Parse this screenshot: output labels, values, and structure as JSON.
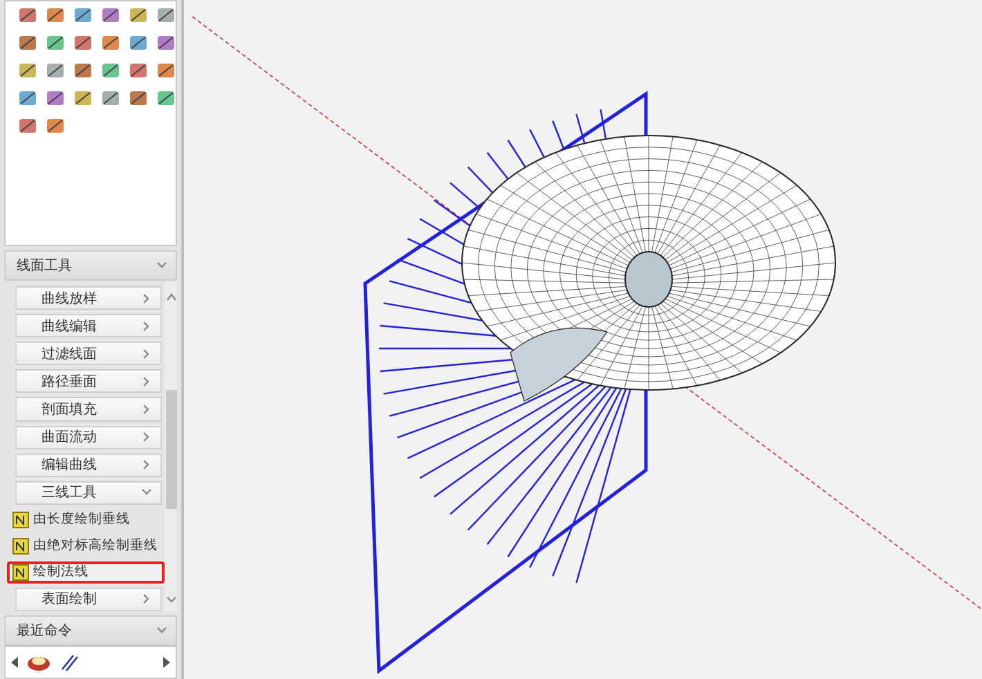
{
  "panel": {
    "tools_section": {
      "title": "线面工具",
      "items": [
        {
          "kind": "category",
          "label": "曲线放样",
          "expanded": false
        },
        {
          "kind": "category",
          "label": "曲线编辑",
          "expanded": false
        },
        {
          "kind": "category",
          "label": "过滤线面",
          "expanded": false
        },
        {
          "kind": "category",
          "label": "路径垂面",
          "expanded": false
        },
        {
          "kind": "category",
          "label": "剖面填充",
          "expanded": false
        },
        {
          "kind": "category",
          "label": "曲面流动",
          "expanded": false
        },
        {
          "kind": "category",
          "label": "编辑曲线",
          "expanded": false
        },
        {
          "kind": "category",
          "label": "三线工具",
          "expanded": true
        },
        {
          "kind": "command",
          "label": "由长度绘制垂线",
          "selected": false
        },
        {
          "kind": "command",
          "label": "由绝对标高绘制垂线",
          "selected": false
        },
        {
          "kind": "command",
          "label": "绘制法线",
          "selected": true
        },
        {
          "kind": "category",
          "label": "表面绘制",
          "expanded": false
        }
      ]
    },
    "recent_section": {
      "title": "最近命令"
    }
  }
}
